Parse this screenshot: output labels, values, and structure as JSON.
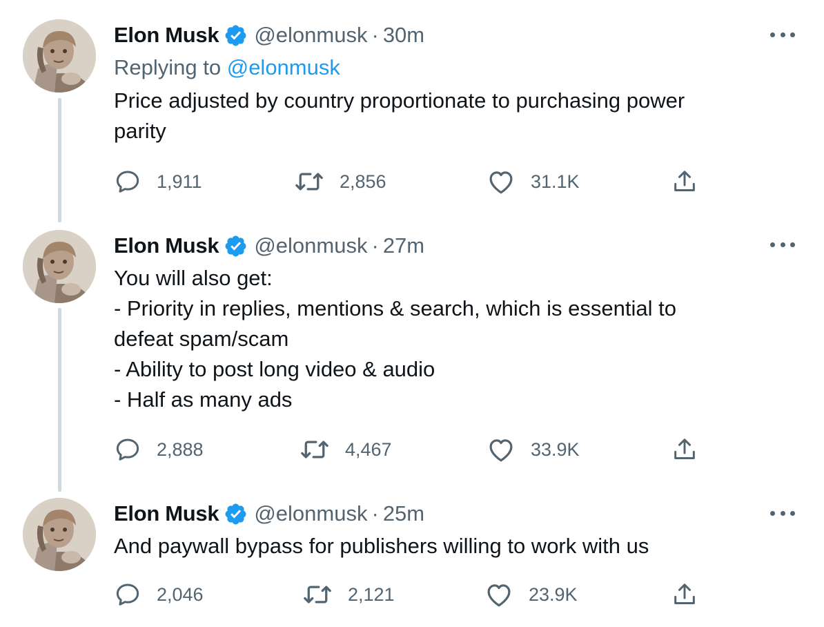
{
  "accent_color": "#1d9bf0",
  "muted_color": "#536471",
  "icons": {
    "verified": "verified-badge-icon",
    "more": "more-options-icon",
    "reply": "reply-icon",
    "retweet": "retweet-icon",
    "like": "like-icon",
    "share": "share-icon"
  },
  "tweets": [
    {
      "name": "Elon Musk",
      "handle": "@elonmusk",
      "separator": "·",
      "time": "30m",
      "replying_label": "Replying to",
      "replying_mention": "@elonmusk",
      "text_lines": [
        "Price adjusted by country proportionate to purchasing power",
        "parity"
      ],
      "replies": "1,911",
      "retweets": "2,856",
      "likes": "31.1K"
    },
    {
      "name": "Elon Musk",
      "handle": "@elonmusk",
      "separator": "·",
      "time": "27m",
      "text_lines": [
        "You will also get:",
        "- Priority in replies, mentions & search, which is essential to",
        "defeat spam/scam",
        "- Ability to post long video & audio",
        "- Half as many ads"
      ],
      "replies": "2,888",
      "retweets": "4,467",
      "likes": "33.9K"
    },
    {
      "name": "Elon Musk",
      "handle": "@elonmusk",
      "separator": "·",
      "time": "25m",
      "text_lines": [
        "And paywall bypass for publishers willing to work with us"
      ],
      "replies": "2,046",
      "retweets": "2,121",
      "likes": "23.9K"
    }
  ]
}
